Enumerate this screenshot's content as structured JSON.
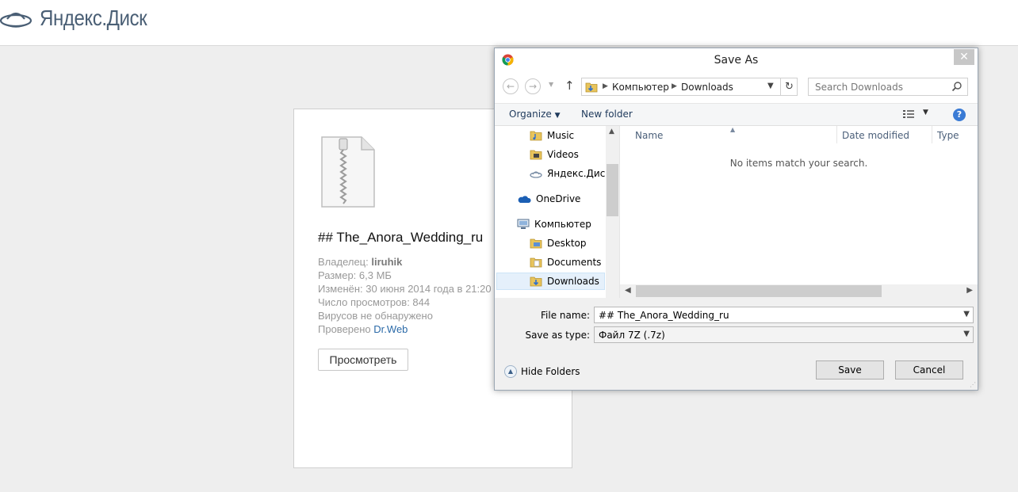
{
  "page": {
    "logo_text": "Яндекс.Диск",
    "file": {
      "name": "## The_Anora_Wedding_ru",
      "owner_label": "Владелец:",
      "owner": "liruhik",
      "size": "Размер: 6,3 МБ",
      "modified": "Изменён: 30 июня 2014 года в 21:20",
      "views": "Число просмотров: 844",
      "virus": "Вирусов не обнаружено",
      "checked_label": "Проверено",
      "checked_by": "Dr.Web",
      "view_button": "Просмотреть"
    }
  },
  "dialog": {
    "title": "Save As",
    "close": "✕",
    "breadcrumb": [
      "Компьютер",
      "Downloads"
    ],
    "search_placeholder": "Search Downloads",
    "toolbar": {
      "organize": "Organize",
      "new_folder": "New folder",
      "help": "?"
    },
    "tree": [
      {
        "label": "Music",
        "icon": "music-folder-icon"
      },
      {
        "label": "Videos",
        "icon": "videos-folder-icon"
      },
      {
        "label": "Яндекс.Диск",
        "icon": "yandex-disk-icon"
      },
      {
        "label": "OneDrive",
        "icon": "onedrive-icon"
      },
      {
        "label": "Компьютер",
        "icon": "computer-icon"
      },
      {
        "label": "Desktop",
        "icon": "desktop-folder-icon"
      },
      {
        "label": "Documents",
        "icon": "documents-folder-icon"
      },
      {
        "label": "Downloads",
        "icon": "downloads-folder-icon",
        "selected": true
      }
    ],
    "columns": [
      "Name",
      "Date modified",
      "Type"
    ],
    "empty_message": "No items match your search.",
    "file_name_label": "File name:",
    "file_name_value": "## The_Anora_Wedding_ru",
    "save_as_type_label": "Save as type:",
    "save_as_type_value": "Файл 7Z (.7z)",
    "hide_folders": "Hide Folders",
    "save_button": "Save",
    "cancel_button": "Cancel"
  }
}
